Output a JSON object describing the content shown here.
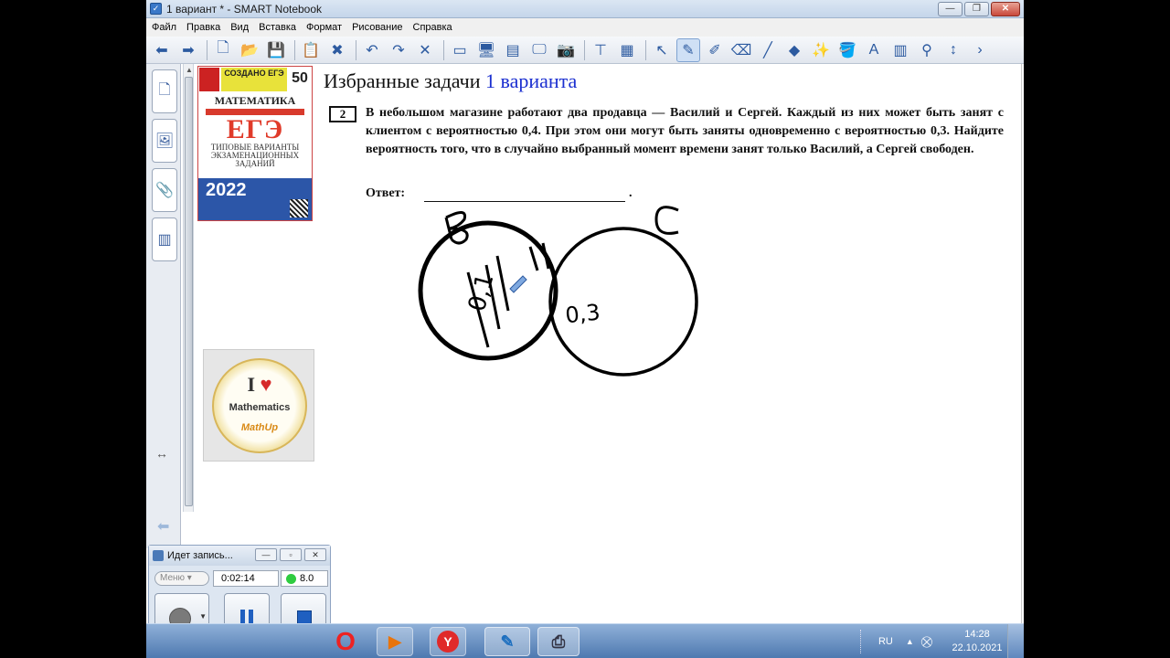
{
  "window": {
    "title": "1 вариант * - SMART Notebook",
    "app_icon": "notebook-icon",
    "buttons": {
      "minimize": "—",
      "maximize": "❐",
      "close": "✕"
    }
  },
  "menu": [
    "Файл",
    "Правка",
    "Вид",
    "Вставка",
    "Формат",
    "Рисование",
    "Справка"
  ],
  "toolbar": {
    "tools": [
      {
        "name": "back-icon",
        "glyph": "⬅"
      },
      {
        "name": "forward-icon",
        "glyph": "➡"
      },
      {
        "name": "add-page-icon",
        "glyph": "🗋"
      },
      {
        "name": "open-file-icon",
        "glyph": "📂"
      },
      {
        "name": "save-icon",
        "glyph": "💾"
      },
      {
        "name": "paste-icon",
        "glyph": "📋"
      },
      {
        "name": "delete-page-icon",
        "glyph": "✖"
      },
      {
        "name": "undo-icon",
        "glyph": "↶"
      },
      {
        "name": "redo-icon",
        "glyph": "↷"
      },
      {
        "name": "delete-icon",
        "glyph": "✕"
      },
      {
        "name": "screen-shade-icon",
        "glyph": "▭"
      },
      {
        "name": "full-screen-icon",
        "glyph": "🖥"
      },
      {
        "name": "dual-page-icon",
        "glyph": "▤"
      },
      {
        "name": "monitor-icon",
        "glyph": "🖵"
      },
      {
        "name": "camera-icon",
        "glyph": "📷"
      },
      {
        "name": "document-camera-icon",
        "glyph": "⊤"
      },
      {
        "name": "table-icon",
        "glyph": "▦"
      },
      {
        "name": "select-icon",
        "glyph": "↖"
      },
      {
        "name": "pen-icon",
        "glyph": "✎"
      },
      {
        "name": "creative-pen-icon",
        "glyph": "✐"
      },
      {
        "name": "eraser-icon",
        "glyph": "⌫"
      },
      {
        "name": "line-icon",
        "glyph": "╱"
      },
      {
        "name": "shapes-icon",
        "glyph": "◆"
      },
      {
        "name": "magic-pen-icon",
        "glyph": "✨"
      },
      {
        "name": "fill-icon",
        "glyph": "🪣"
      },
      {
        "name": "text-icon",
        "glyph": "A"
      },
      {
        "name": "properties-icon",
        "glyph": "▥"
      },
      {
        "name": "measure-icon",
        "glyph": "⚲"
      },
      {
        "name": "move-toolbar-icon",
        "glyph": "↕"
      },
      {
        "name": "more-icon",
        "glyph": "›"
      }
    ],
    "selected": "pen-icon"
  },
  "sidetabs": [
    {
      "name": "page-sorter-tab",
      "glyph": "🗋"
    },
    {
      "name": "gallery-tab",
      "glyph": "🖼"
    },
    {
      "name": "attachments-tab",
      "glyph": "📎"
    },
    {
      "name": "properties-tab",
      "glyph": "▥"
    }
  ],
  "page": {
    "heading_main": "Избранные задачи ",
    "heading_accent": "1 варианта",
    "task_number": "2",
    "task_text": "В небольшом магазине работают два продавца — Василий и Сергей. Каждый из них может быть занят с клиентом с вероятностью 0,4. При этом они могут быть заняты одновременно с вероятностью 0,3. Найдите вероятность того, что в случайно выбранный момент времени занят только Василий, а Сергей свободен.",
    "answer_label": "Ответ:",
    "answer_dot": ".",
    "ink_labels": {
      "left_circle": "B",
      "right_circle": "C",
      "left_value": "0,1",
      "intersection_value": "0,3"
    }
  },
  "book_cover": {
    "badge": "СОЗДАНО ЕГЭ",
    "count": "50",
    "subject": "МАТЕМАТИКА",
    "exam": "ЕГЭ",
    "line1": "ТИПОВЫЕ ВАРИАНТЫ",
    "line2": "ЭКЗАМЕНАЦИОННЫХ",
    "line3": "ЗАДАНИЙ",
    "year": "2022"
  },
  "math_badge": {
    "top": "I",
    "word": "Mathematics",
    "brand": "MathUp"
  },
  "recorder": {
    "title": "Идет запись...",
    "menu_label": "Меню",
    "elapsed": "0:02:14",
    "level": "8.0"
  },
  "taskbar": {
    "lang": "RU",
    "time": "14:28",
    "date": "22.10.2021"
  },
  "colors": {
    "accent_heading": "#1b2fd0",
    "title_bar": "#c4d5ea",
    "taskbar": "#4e79b0"
  }
}
